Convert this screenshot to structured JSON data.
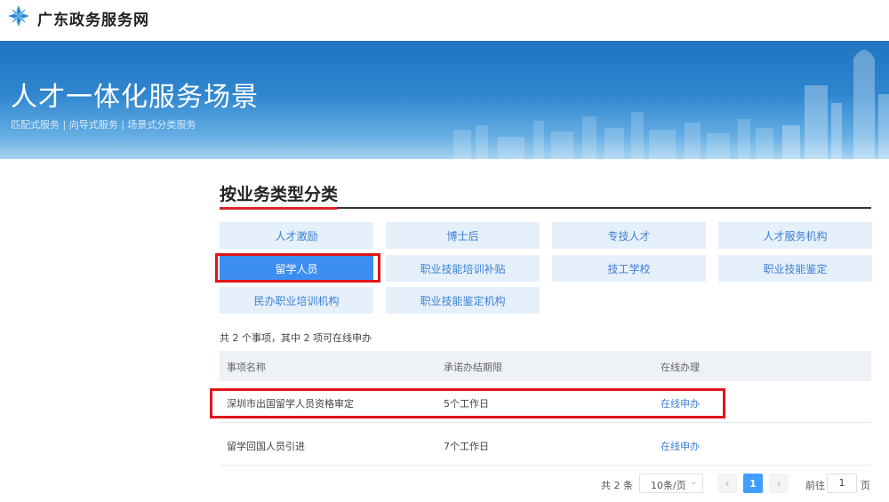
{
  "header": {
    "site_title": "广东政务服务网",
    "logo_icon": "snowflake-logo-icon"
  },
  "banner": {
    "title": "人才一体化服务场景",
    "subtitle": "匹配式服务 | 向导式服务 | 场景式分类服务"
  },
  "section": {
    "title": "按业务类型分类"
  },
  "categories": [
    {
      "label": "人才激励"
    },
    {
      "label": "博士后"
    },
    {
      "label": "专技人才"
    },
    {
      "label": "人才服务机构"
    },
    {
      "label": "留学人员",
      "active": true
    },
    {
      "label": "职业技能培训补贴"
    },
    {
      "label": "技工学校"
    },
    {
      "label": "职业技能鉴定"
    },
    {
      "label": "民办职业培训机构"
    },
    {
      "label": "职业技能鉴定机构"
    }
  ],
  "summary": "共 2 个事项，其中 2 项可在线申办",
  "table": {
    "headers": [
      "事项名称",
      "承诺办结期限",
      "在线办理"
    ],
    "rows": [
      {
        "name": "深圳市出国留学人员资格审定",
        "deadline": "5个工作日",
        "action": "在线申办"
      },
      {
        "name": "留学回国人员引进",
        "deadline": "7个工作日",
        "action": "在线申办"
      }
    ]
  },
  "pagination": {
    "total": "共 2 条",
    "page_size": "10条/页",
    "prev_icon": "chevron-left-icon",
    "next_icon": "chevron-right-icon",
    "current_page": "1",
    "goto_label": "前往",
    "goto_value": "1",
    "page_suffix": "页"
  },
  "colors": {
    "accent": "#3c8ef0",
    "highlight_border": "#e0151b",
    "link": "#3a7fd5"
  }
}
